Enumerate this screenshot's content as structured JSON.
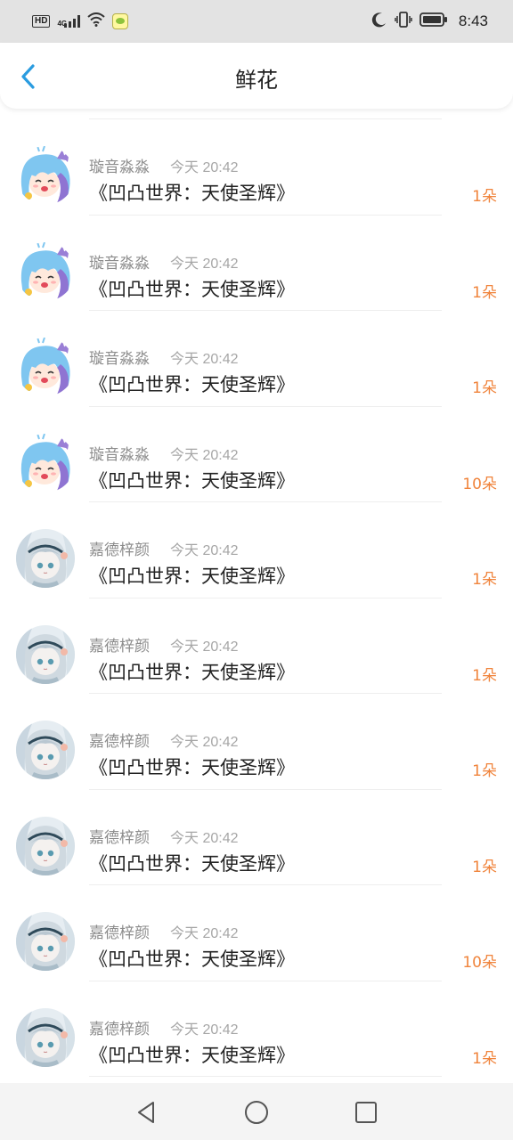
{
  "status_bar": {
    "hd_label": "HD",
    "network_label": "4G",
    "time": "8:43"
  },
  "header": {
    "title": "鲜花",
    "back_icon": "chevron-left-icon"
  },
  "entries": [
    {
      "username": "璇音淼淼",
      "time": "今天 20:42",
      "title": "《凹凸世界：天使圣辉》",
      "count": "1朵",
      "avatar": "blue-hair-girl-avatar"
    },
    {
      "username": "璇音淼淼",
      "time": "今天 20:42",
      "title": "《凹凸世界：天使圣辉》",
      "count": "1朵",
      "avatar": "blue-hair-girl-avatar"
    },
    {
      "username": "璇音淼淼",
      "time": "今天 20:42",
      "title": "《凹凸世界：天使圣辉》",
      "count": "1朵",
      "avatar": "blue-hair-girl-avatar"
    },
    {
      "username": "璇音淼淼",
      "time": "今天 20:42",
      "title": "《凹凸世界：天使圣辉》",
      "count": "10朵",
      "avatar": "blue-hair-girl-avatar"
    },
    {
      "username": "嘉德梓颜",
      "time": "今天 20:42",
      "title": "《凹凸世界：天使圣辉》",
      "count": "1朵",
      "avatar": "silver-hair-girl-avatar"
    },
    {
      "username": "嘉德梓颜",
      "time": "今天 20:42",
      "title": "《凹凸世界：天使圣辉》",
      "count": "1朵",
      "avatar": "silver-hair-girl-avatar"
    },
    {
      "username": "嘉德梓颜",
      "time": "今天 20:42",
      "title": "《凹凸世界：天使圣辉》",
      "count": "1朵",
      "avatar": "silver-hair-girl-avatar"
    },
    {
      "username": "嘉德梓颜",
      "time": "今天 20:42",
      "title": "《凹凸世界：天使圣辉》",
      "count": "1朵",
      "avatar": "silver-hair-girl-avatar"
    },
    {
      "username": "嘉德梓颜",
      "time": "今天 20:42",
      "title": "《凹凸世界：天使圣辉》",
      "count": "10朵",
      "avatar": "silver-hair-girl-avatar"
    },
    {
      "username": "嘉德梓颜",
      "time": "今天 20:42",
      "title": "《凹凸世界：天使圣辉》",
      "count": "1朵",
      "avatar": "silver-hair-girl-avatar"
    }
  ],
  "colors": {
    "accent_blue": "#2a9ce0",
    "count_orange": "#f0843c",
    "muted_text": "#8c8c8c"
  },
  "nav_bar": {
    "back_icon": "triangle-back-icon",
    "home_icon": "circle-home-icon",
    "recents_icon": "square-recents-icon"
  }
}
